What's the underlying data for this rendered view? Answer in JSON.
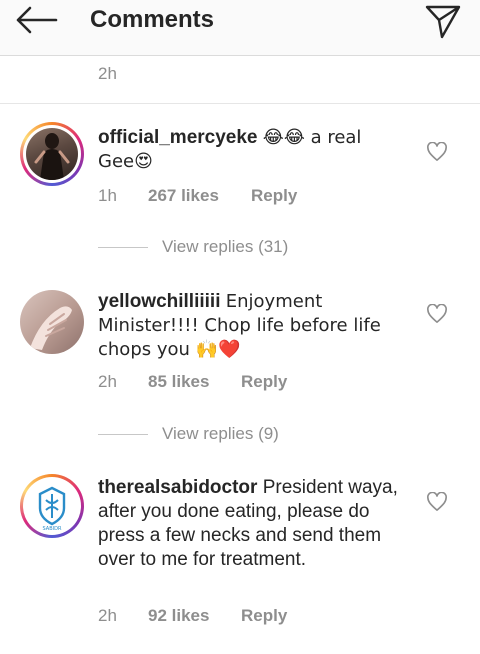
{
  "header": {
    "title": "Comments"
  },
  "top_strip": {
    "time": "2h"
  },
  "comments": [
    {
      "username": "official_mercyeke",
      "text": "😂😂 a real Gee😍",
      "time": "1h",
      "likes": "267 likes",
      "reply": "Reply",
      "view_replies": "View replies (31)"
    },
    {
      "username": "yellowchilliiiii",
      "text": "Enjoyment Minister!!!! Chop life before life chops you 🙌❤️",
      "time": "2h",
      "likes": "85 likes",
      "reply": "Reply",
      "view_replies": "View replies (9)"
    },
    {
      "username": "therealsabidoctor",
      "text": "President waya, after you done eating, please do press a few necks and send them over to me for treatment.",
      "time": "2h",
      "likes": "92 likes",
      "reply": "Reply",
      "avatar_text": "SABIDR"
    }
  ]
}
